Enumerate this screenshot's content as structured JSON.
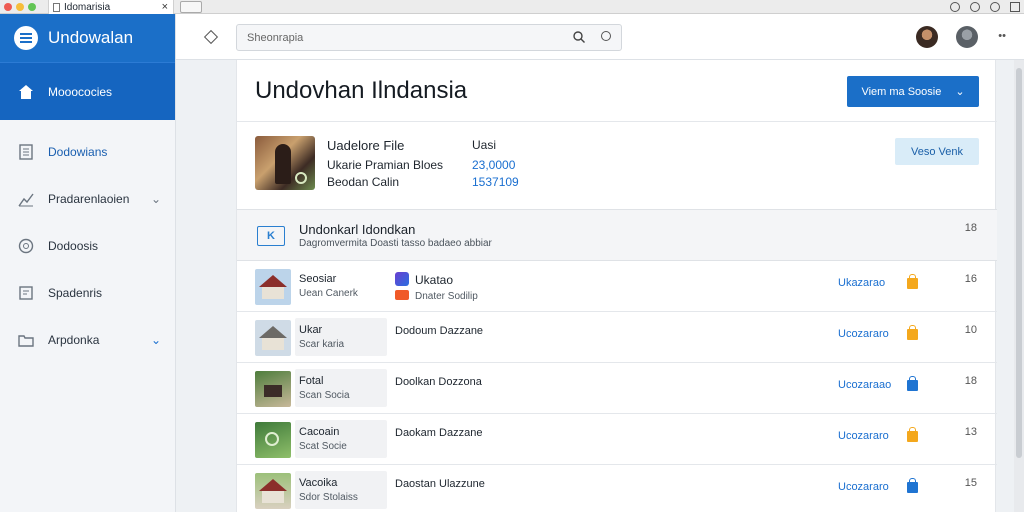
{
  "window": {
    "tab_title": "Idomarisia",
    "close_glyph": "×",
    "traffic_colors": [
      "#ee5b52",
      "#f6bd3a",
      "#62c554"
    ]
  },
  "sidebar": {
    "brand": "Undowalan",
    "active_item": {
      "label": "Mooococies",
      "icon": "home-icon"
    },
    "items": [
      {
        "label": "Dodowians",
        "icon": "document-icon",
        "has_chevron": false
      },
      {
        "label": "Pradarenlaoien",
        "icon": "chart-icon",
        "has_chevron": true
      },
      {
        "label": "Dodoosis",
        "icon": "globe-icon",
        "has_chevron": false
      },
      {
        "label": "Spadenris",
        "icon": "file-icon",
        "has_chevron": false
      },
      {
        "label": "Arpdonka",
        "icon": "folder-icon",
        "has_chevron": true
      }
    ]
  },
  "topbar": {
    "search_value": "Sheonrapia",
    "more_glyph": "••"
  },
  "page": {
    "title": "Undovhan Ilndansia",
    "primary_button": "Viem ma Soosie",
    "file_card": {
      "rows": [
        {
          "label": "Uadelore File",
          "value": "Uasi",
          "value_blue": false
        },
        {
          "label": "Ukarie Pramian Bloes",
          "value": "23,0000",
          "value_blue": true
        },
        {
          "label": "Beodan Calin",
          "value": "1537109",
          "value_blue": true
        }
      ],
      "action_button": "Veso Venk"
    },
    "section": {
      "title": "Undonkarl Idondkan",
      "subtitle": "Dagromvermita Doasti tasso badaeo abbiar",
      "count": "18"
    },
    "rows": [
      {
        "title": "Seosiar",
        "sub": "Uean Canerk",
        "desc": "Ukatao",
        "desc_sub": "Dnater Sodilip",
        "status": "Ukazarao",
        "lock": "orange",
        "num": "16",
        "thumb": "house"
      },
      {
        "title": "Ukar",
        "sub": "Scar karia",
        "desc": "Dodoum Dazzane",
        "status": "Ucozararo",
        "lock": "orange",
        "num": "10",
        "thumb": "house"
      },
      {
        "title": "Fotal",
        "sub": "Scan Socia",
        "desc": "Doolkan Dozzona",
        "status": "Ucozaraao",
        "lock": "blue",
        "num": "18",
        "thumb": "people"
      },
      {
        "title": "Cacoain",
        "sub": "Scat Socie",
        "desc": "Daokam Dazzane",
        "status": "Ucozararo",
        "lock": "orange",
        "num": "13",
        "thumb": "green"
      },
      {
        "title": "Vacoika",
        "sub": "Sdor Stolaiss",
        "desc": "Daostan Ulazzune",
        "status": "Ucozararo",
        "lock": "blue",
        "num": "15",
        "thumb": "house"
      }
    ],
    "colors": {
      "accent": "#1b6fc8",
      "status": "#1a6fd0",
      "lock_orange": "#f4a81d",
      "lock_blue": "#1f74d2"
    }
  }
}
